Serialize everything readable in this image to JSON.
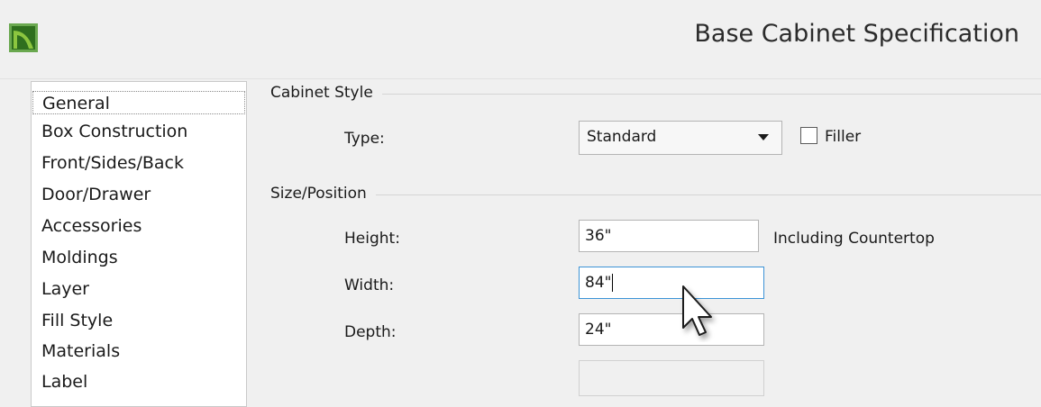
{
  "window": {
    "title": "Base Cabinet Specification",
    "icon": "green-app-icon"
  },
  "sidebar": {
    "items": [
      {
        "label": "General",
        "selected": true
      },
      {
        "label": "Box Construction",
        "selected": false
      },
      {
        "label": "Front/Sides/Back",
        "selected": false
      },
      {
        "label": "Door/Drawer",
        "selected": false
      },
      {
        "label": "Accessories",
        "selected": false
      },
      {
        "label": "Moldings",
        "selected": false
      },
      {
        "label": "Layer",
        "selected": false
      },
      {
        "label": "Fill Style",
        "selected": false
      },
      {
        "label": "Materials",
        "selected": false
      },
      {
        "label": "Label",
        "selected": false
      }
    ]
  },
  "cabinet_style": {
    "section_label": "Cabinet Style",
    "type_label": "Type:",
    "type_value": "Standard",
    "filler_label": "Filler",
    "filler_checked": false
  },
  "size_position": {
    "section_label": "Size/Position",
    "height_label": "Height:",
    "height_value": "36\"",
    "height_note": "Including Countertop",
    "width_label": "Width:",
    "width_value": "84\"",
    "depth_label": "Depth:",
    "depth_value": "24\""
  },
  "colors": {
    "accent_focus": "#3c93d6",
    "icon_green": "#4e9a2a"
  }
}
